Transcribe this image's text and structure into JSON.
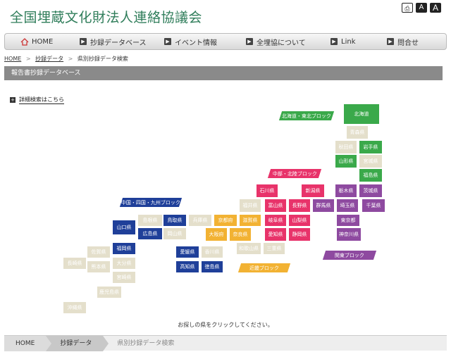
{
  "site": {
    "title": "全国埋蔵文化財法人連絡協議会"
  },
  "tools": {
    "print_icon": "printer-icon",
    "font_small": "A",
    "font_large": "A"
  },
  "nav": [
    {
      "label": "HOME",
      "icon": "home-icon"
    },
    {
      "label": "抄録データベース",
      "icon": "bullet-icon"
    },
    {
      "label": "イベント情報",
      "icon": "bullet-icon"
    },
    {
      "label": "全埋協について",
      "icon": "bullet-icon"
    },
    {
      "label": "Link",
      "icon": "bullet-icon"
    },
    {
      "label": "問合せ",
      "icon": "bullet-icon"
    }
  ],
  "breadcrumb": {
    "home": "HOME",
    "sep": ">",
    "data": "抄録データ",
    "current": "県別抄録データ検索"
  },
  "section_title": "報告書抄録データベース",
  "detail_search": {
    "icon": "plus-icon",
    "label": "詳細検索はこちら"
  },
  "regions": {
    "hokkaido_tohoku": "北海道・東北ブロック",
    "chubu_hokuriku": "中部・北陸ブロック",
    "chugoku_shikoku_kyushu": "中国・四国・九州ブロック",
    "kinki": "近畿ブロック",
    "kanto": "関東ブロック"
  },
  "colors": {
    "hokkaido_tohoku": "#3aa94a",
    "chubu_hokuriku": "#e8336a",
    "chugoku_shikoku_kyushu": "#1f3f99",
    "kinki": "#f2b233",
    "kanto": "#8e4aa0",
    "inactive": "#e4dfcb"
  },
  "prefectures": {
    "hokkaido": "北海道",
    "aomori": "青森県",
    "akita": "秋田県",
    "iwate": "岩手県",
    "yamagata": "山形県",
    "miyagi": "宮城県",
    "fukushima": "福島県",
    "ishikawa": "石川県",
    "niigata": "新潟県",
    "tochigi": "栃木県",
    "ibaraki": "茨城県",
    "fukui": "福井県",
    "toyama": "富山県",
    "nagano": "長野県",
    "gunma": "群馬県",
    "saitama": "埼玉県",
    "chiba": "千葉県",
    "yamaguchi": "山口県",
    "shimane": "島根県",
    "tottori": "鳥取県",
    "hyogo": "兵庫県",
    "kyoto": "京都府",
    "shiga": "滋賀県",
    "gifu": "岐阜県",
    "yamanashi": "山梨県",
    "tokyo": "東京都",
    "hiroshima": "広島県",
    "okayama": "岡山県",
    "osaka": "大阪府",
    "nara": "奈良県",
    "aichi": "愛知県",
    "shizuoka": "静岡県",
    "kanagawa": "神奈川県",
    "saga": "佐賀県",
    "fukuoka": "福岡県",
    "ehime": "愛媛県",
    "kagawa": "香川県",
    "wakayama": "和歌山県",
    "mie": "三重県",
    "nagasaki": "長崎県",
    "kumamoto": "熊本県",
    "oita": "大分県",
    "kochi": "高知県",
    "tokushima": "徳島県",
    "miyazaki": "宮崎県",
    "kagoshima": "鹿児島県",
    "okinawa": "沖縄県"
  },
  "caption": "お探しの県をクリックしてください。",
  "bottom_breadcrumb": [
    "HOME",
    "抄録データ",
    "県別抄録データ検索"
  ]
}
